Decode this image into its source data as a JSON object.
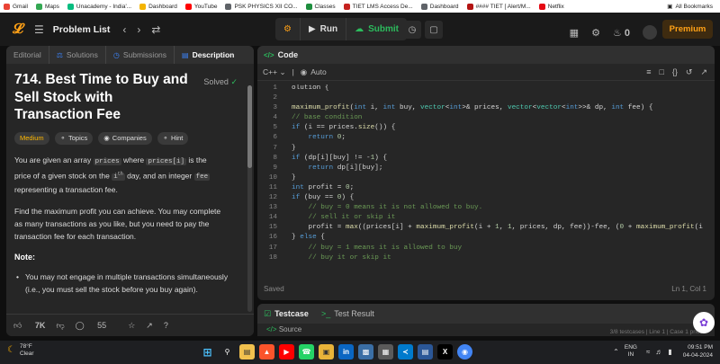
{
  "bookmarks": {
    "items": [
      {
        "label": "Gmail",
        "color": "#ea4335"
      },
      {
        "label": "Maps",
        "color": "#34a853"
      },
      {
        "label": "Unacademy - India'...",
        "color": "#08bd80"
      },
      {
        "label": "Dashboard",
        "color": "#f4b400"
      },
      {
        "label": "YouTube",
        "color": "#ff0000"
      },
      {
        "label": "PSK PHYSICS XII CO...",
        "color": "#5f6368"
      },
      {
        "label": "Classes",
        "color": "#1e8e3e"
      },
      {
        "label": "TIET LMS Access De...",
        "color": "#c5221f"
      },
      {
        "label": "Dashboard",
        "color": "#5f6368"
      },
      {
        "label": "#### TIET [ Alert/M...",
        "color": "#b31412"
      },
      {
        "label": "Netflix",
        "color": "#e50914"
      }
    ],
    "all_bookmarks": "All Bookmarks"
  },
  "topnav": {
    "problem_list": "Problem List",
    "run": "Run",
    "submit": "Submit",
    "streak": "0",
    "premium": "Premium"
  },
  "left": {
    "tabs": [
      "Editorial",
      "Solutions",
      "Submissions",
      "Description"
    ],
    "title": "714. Best Time to Buy and Sell Stock with Transaction Fee",
    "solved": "Solved",
    "chips": [
      "Medium",
      "Topics",
      "Companies",
      "Hint"
    ],
    "p1": {
      "a": "You are given an array ",
      "c1": "prices",
      "b": " where ",
      "c2": "prices[i]",
      "c": " is the price of a given stock on the ",
      "c3": "i",
      "sup": "th",
      "d": " day, and an integer ",
      "c4": "fee",
      "e": " representing a transaction fee."
    },
    "p2": "Find the maximum profit you can achieve. You may complete as many transactions as you like, but you need to pay the transaction fee for each transaction.",
    "note": "Note:",
    "bullet": "You may not engage in multiple transactions simultaneously (i.e., you must sell the stock before you buy again).",
    "footer": {
      "likes": "7K",
      "comments": "55"
    }
  },
  "code": {
    "title": "Code",
    "language": "C++",
    "mode": "Auto",
    "lines": [
      {
        "n": "1",
        "t": "olution {"
      },
      {
        "n": "2",
        "t": ""
      },
      {
        "n": "3",
        "t": "maximum_profit(int i, int buy, vector<int>& prices, vector<vector<int>>& dp, int fee) {"
      },
      {
        "n": "4",
        "t": "// base condition"
      },
      {
        "n": "5",
        "t": "if (i == prices.size()) {"
      },
      {
        "n": "6",
        "t": "    return 0;"
      },
      {
        "n": "7",
        "t": "}"
      },
      {
        "n": "8",
        "t": "if (dp[i][buy] != -1) {"
      },
      {
        "n": "9",
        "t": "    return dp[i][buy];"
      },
      {
        "n": "10",
        "t": "}"
      },
      {
        "n": "11",
        "t": "int profit = 0;"
      },
      {
        "n": "12",
        "t": "if (buy == 0) {"
      },
      {
        "n": "13",
        "t": "    // buy = 0 means it is not allowed to buy."
      },
      {
        "n": "14",
        "t": "    // sell it or skip it"
      },
      {
        "n": "15",
        "t": "    profit = max((prices[i] + maximum_profit(i + 1, 1, prices, dp, fee))-fee, (0 + maximum_profit(i"
      },
      {
        "n": "16",
        "t": "} else {"
      },
      {
        "n": "17",
        "t": "    // buy = 1 means it is allowed to buy"
      },
      {
        "n": "18",
        "t": "    // buy it or skip it"
      }
    ],
    "saved": "Saved",
    "position": "Ln 1, Col 1"
  },
  "test": {
    "testcase": "Testcase",
    "result": "Test Result",
    "source": "Source",
    "cases": "3/8 testcases | Line 1 | Case 1 prices"
  },
  "taskbar": {
    "temp": "78°F",
    "weather": "Clear",
    "lang1": "ENG",
    "lang2": "IN",
    "time": "09:51 PM",
    "date": "04-04-2024"
  }
}
